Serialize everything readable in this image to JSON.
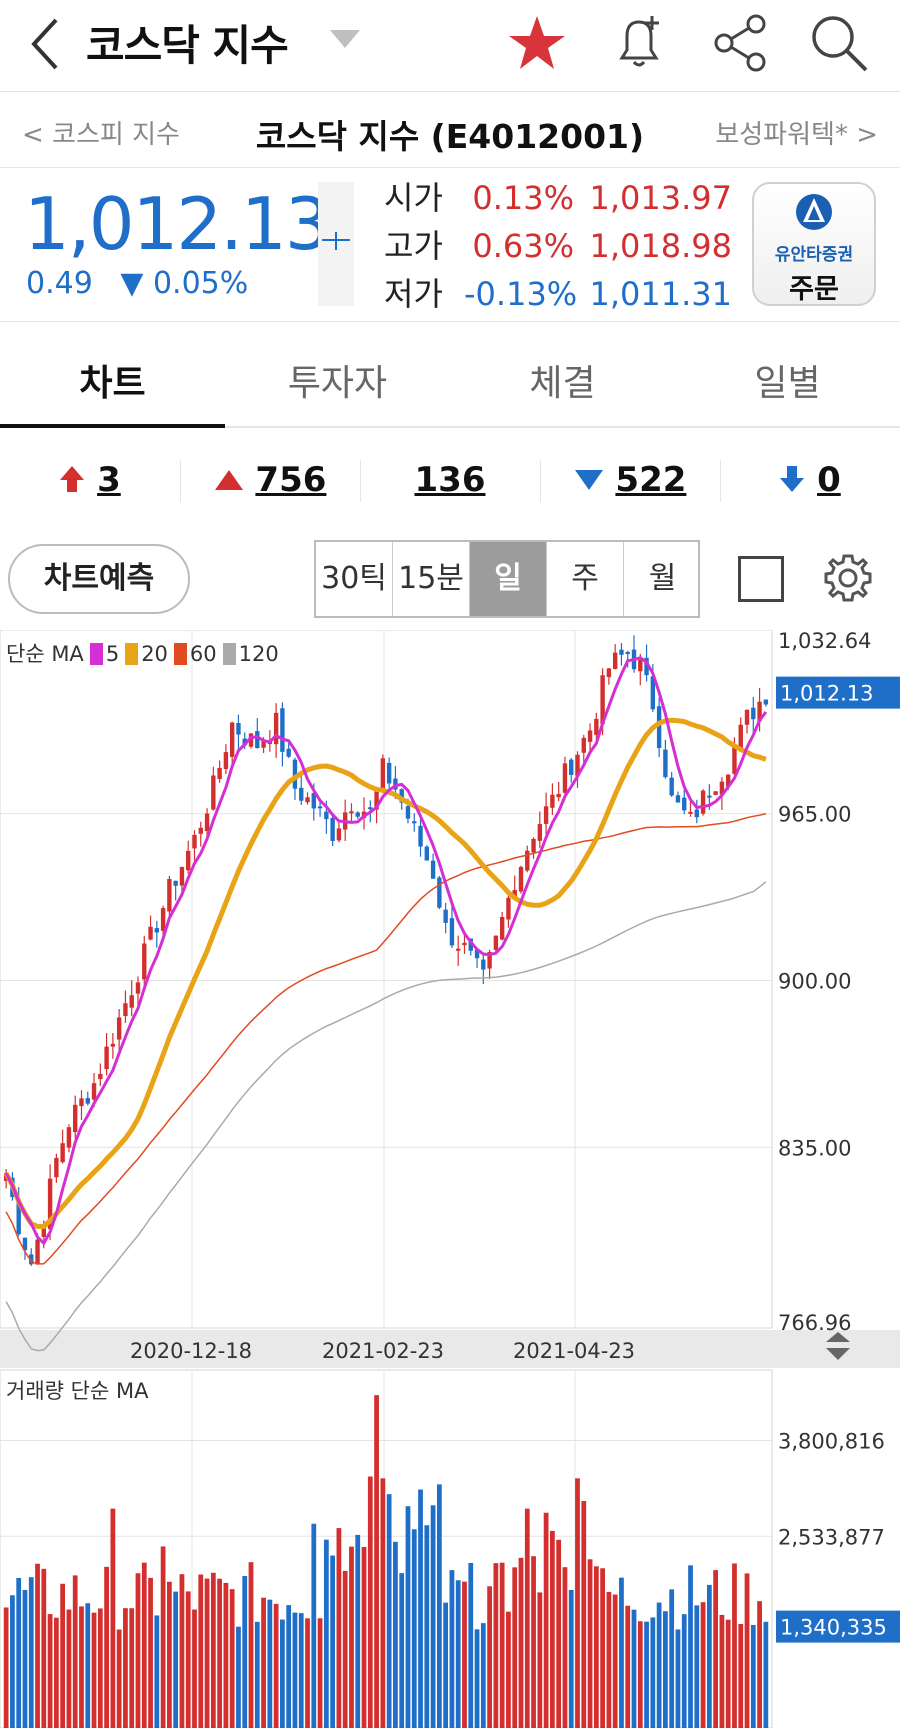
{
  "header": {
    "title": "코스닥 지수"
  },
  "subnav": {
    "prev": "< 코스피 지수",
    "center": "코스닥 지수 (E4012001)",
    "next": "보성파워텍* >"
  },
  "quote": {
    "price": "1,012.13",
    "change_abs": "0.49",
    "change_pct": "▼ 0.05%",
    "open_label": "시가",
    "open_pct": "0.13%",
    "open_val": "1,013.97",
    "high_label": "고가",
    "high_pct": "0.63%",
    "high_val": "1,018.98",
    "low_label": "저가",
    "low_pct": "-0.13%",
    "low_val": "1,011.31"
  },
  "order_button": {
    "brand": "유안타증권",
    "label": "주문"
  },
  "tabs": [
    "차트",
    "투자자",
    "체결",
    "일별"
  ],
  "breadth": {
    "upper_limit": "3",
    "up": "756",
    "flat": "136",
    "down": "522",
    "lower_limit": "0"
  },
  "controls": {
    "predict": "차트예측",
    "periods": [
      "30틱",
      "15분",
      "일",
      "주",
      "월"
    ],
    "selected_period": "일"
  },
  "legend": {
    "prefix": "단순 MA",
    "ma": [
      "5",
      "20",
      "60",
      "120"
    ]
  },
  "volume_label": "거래량 단순 MA",
  "colors": {
    "up": "#d42f2f",
    "down": "#1f6fc9",
    "ma5": "#d42fd4",
    "ma20": "#e8a317",
    "ma60": "#e24a1f",
    "ma120": "#aaaaaa"
  },
  "chart_data": [
    {
      "type": "candlestick",
      "yticks": [
        "1,032.64",
        "965.00",
        "900.00",
        "835.00",
        "766.96"
      ],
      "yvalues": [
        1032.64,
        965.0,
        900.0,
        835.0,
        766.96
      ],
      "current_label": "1,012.13",
      "current": 1012.13,
      "x_labels": [
        "2020-12-18",
        "2021-02-23",
        "2021-04-23"
      ],
      "ylim": [
        766.96,
        1032.64
      ],
      "close_path": [
        [
          0,
          825
        ],
        [
          2,
          805
        ],
        [
          4,
          790
        ],
        [
          6,
          808
        ],
        [
          8,
          830
        ],
        [
          10,
          845
        ],
        [
          14,
          860
        ],
        [
          18,
          885
        ],
        [
          22,
          910
        ],
        [
          26,
          935
        ],
        [
          30,
          955
        ],
        [
          33,
          975
        ],
        [
          36,
          1000
        ],
        [
          38,
          995
        ],
        [
          40,
          992
        ],
        [
          43,
          1000
        ],
        [
          46,
          975
        ],
        [
          49,
          968
        ],
        [
          52,
          958
        ],
        [
          55,
          970
        ],
        [
          58,
          965
        ],
        [
          60,
          982
        ],
        [
          62,
          975
        ],
        [
          65,
          958
        ],
        [
          68,
          942
        ],
        [
          70,
          920
        ],
        [
          73,
          912
        ],
        [
          76,
          900
        ],
        [
          78,
          915
        ],
        [
          81,
          940
        ],
        [
          84,
          958
        ],
        [
          87,
          970
        ],
        [
          90,
          985
        ],
        [
          93,
          998
        ],
        [
          96,
          1022
        ],
        [
          99,
          1028
        ],
        [
          101,
          1022
        ],
        [
          103,
          1008
        ],
        [
          106,
          970
        ],
        [
          109,
          962
        ],
        [
          112,
          975
        ],
        [
          115,
          985
        ],
        [
          118,
          1002
        ],
        [
          121,
          1012
        ]
      ]
    },
    {
      "type": "bar",
      "title": "거래량 단순 MA",
      "yticks": [
        "3,800,816",
        "2,533,877",
        "1,340,335"
      ],
      "yvalues": [
        3800816,
        2533877,
        1340335
      ]
    }
  ]
}
